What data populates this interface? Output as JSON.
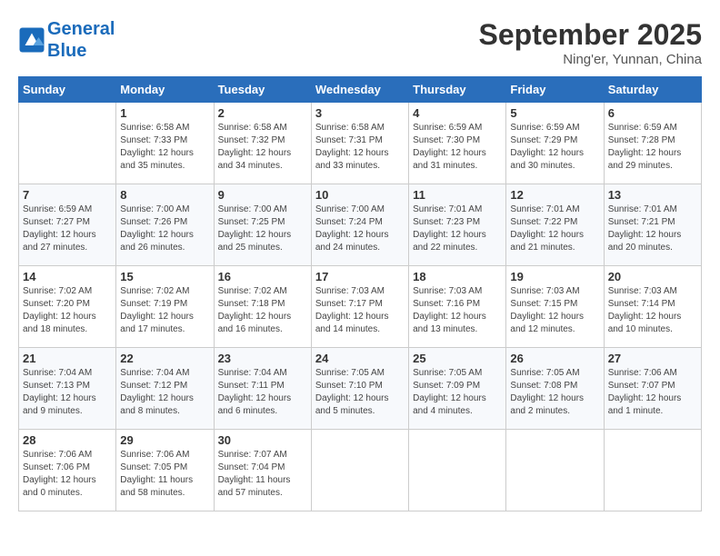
{
  "header": {
    "logo_line1": "General",
    "logo_line2": "Blue",
    "month": "September 2025",
    "location": "Ning'er, Yunnan, China"
  },
  "days_of_week": [
    "Sunday",
    "Monday",
    "Tuesday",
    "Wednesday",
    "Thursday",
    "Friday",
    "Saturday"
  ],
  "weeks": [
    [
      {
        "day": "",
        "info": ""
      },
      {
        "day": "1",
        "info": "Sunrise: 6:58 AM\nSunset: 7:33 PM\nDaylight: 12 hours\nand 35 minutes."
      },
      {
        "day": "2",
        "info": "Sunrise: 6:58 AM\nSunset: 7:32 PM\nDaylight: 12 hours\nand 34 minutes."
      },
      {
        "day": "3",
        "info": "Sunrise: 6:58 AM\nSunset: 7:31 PM\nDaylight: 12 hours\nand 33 minutes."
      },
      {
        "day": "4",
        "info": "Sunrise: 6:59 AM\nSunset: 7:30 PM\nDaylight: 12 hours\nand 31 minutes."
      },
      {
        "day": "5",
        "info": "Sunrise: 6:59 AM\nSunset: 7:29 PM\nDaylight: 12 hours\nand 30 minutes."
      },
      {
        "day": "6",
        "info": "Sunrise: 6:59 AM\nSunset: 7:28 PM\nDaylight: 12 hours\nand 29 minutes."
      }
    ],
    [
      {
        "day": "7",
        "info": "Sunrise: 6:59 AM\nSunset: 7:27 PM\nDaylight: 12 hours\nand 27 minutes."
      },
      {
        "day": "8",
        "info": "Sunrise: 7:00 AM\nSunset: 7:26 PM\nDaylight: 12 hours\nand 26 minutes."
      },
      {
        "day": "9",
        "info": "Sunrise: 7:00 AM\nSunset: 7:25 PM\nDaylight: 12 hours\nand 25 minutes."
      },
      {
        "day": "10",
        "info": "Sunrise: 7:00 AM\nSunset: 7:24 PM\nDaylight: 12 hours\nand 24 minutes."
      },
      {
        "day": "11",
        "info": "Sunrise: 7:01 AM\nSunset: 7:23 PM\nDaylight: 12 hours\nand 22 minutes."
      },
      {
        "day": "12",
        "info": "Sunrise: 7:01 AM\nSunset: 7:22 PM\nDaylight: 12 hours\nand 21 minutes."
      },
      {
        "day": "13",
        "info": "Sunrise: 7:01 AM\nSunset: 7:21 PM\nDaylight: 12 hours\nand 20 minutes."
      }
    ],
    [
      {
        "day": "14",
        "info": "Sunrise: 7:02 AM\nSunset: 7:20 PM\nDaylight: 12 hours\nand 18 minutes."
      },
      {
        "day": "15",
        "info": "Sunrise: 7:02 AM\nSunset: 7:19 PM\nDaylight: 12 hours\nand 17 minutes."
      },
      {
        "day": "16",
        "info": "Sunrise: 7:02 AM\nSunset: 7:18 PM\nDaylight: 12 hours\nand 16 minutes."
      },
      {
        "day": "17",
        "info": "Sunrise: 7:03 AM\nSunset: 7:17 PM\nDaylight: 12 hours\nand 14 minutes."
      },
      {
        "day": "18",
        "info": "Sunrise: 7:03 AM\nSunset: 7:16 PM\nDaylight: 12 hours\nand 13 minutes."
      },
      {
        "day": "19",
        "info": "Sunrise: 7:03 AM\nSunset: 7:15 PM\nDaylight: 12 hours\nand 12 minutes."
      },
      {
        "day": "20",
        "info": "Sunrise: 7:03 AM\nSunset: 7:14 PM\nDaylight: 12 hours\nand 10 minutes."
      }
    ],
    [
      {
        "day": "21",
        "info": "Sunrise: 7:04 AM\nSunset: 7:13 PM\nDaylight: 12 hours\nand 9 minutes."
      },
      {
        "day": "22",
        "info": "Sunrise: 7:04 AM\nSunset: 7:12 PM\nDaylight: 12 hours\nand 8 minutes."
      },
      {
        "day": "23",
        "info": "Sunrise: 7:04 AM\nSunset: 7:11 PM\nDaylight: 12 hours\nand 6 minutes."
      },
      {
        "day": "24",
        "info": "Sunrise: 7:05 AM\nSunset: 7:10 PM\nDaylight: 12 hours\nand 5 minutes."
      },
      {
        "day": "25",
        "info": "Sunrise: 7:05 AM\nSunset: 7:09 PM\nDaylight: 12 hours\nand 4 minutes."
      },
      {
        "day": "26",
        "info": "Sunrise: 7:05 AM\nSunset: 7:08 PM\nDaylight: 12 hours\nand 2 minutes."
      },
      {
        "day": "27",
        "info": "Sunrise: 7:06 AM\nSunset: 7:07 PM\nDaylight: 12 hours\nand 1 minute."
      }
    ],
    [
      {
        "day": "28",
        "info": "Sunrise: 7:06 AM\nSunset: 7:06 PM\nDaylight: 12 hours\nand 0 minutes."
      },
      {
        "day": "29",
        "info": "Sunrise: 7:06 AM\nSunset: 7:05 PM\nDaylight: 11 hours\nand 58 minutes."
      },
      {
        "day": "30",
        "info": "Sunrise: 7:07 AM\nSunset: 7:04 PM\nDaylight: 11 hours\nand 57 minutes."
      },
      {
        "day": "",
        "info": ""
      },
      {
        "day": "",
        "info": ""
      },
      {
        "day": "",
        "info": ""
      },
      {
        "day": "",
        "info": ""
      }
    ]
  ]
}
